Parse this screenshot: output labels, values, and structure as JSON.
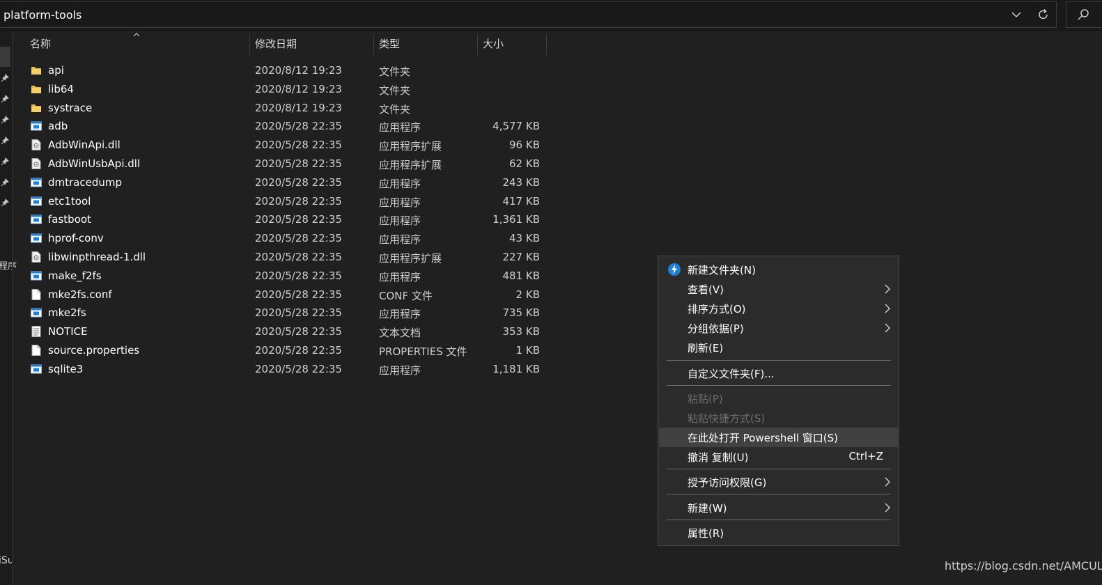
{
  "address_bar": {
    "path": "platform-tools"
  },
  "nav_pane": {
    "partial_label_1": "程序",
    "partial_label_2": "iSu"
  },
  "columns": {
    "name": "名称",
    "date": "修改日期",
    "type": "类型",
    "size": "大小"
  },
  "files": [
    {
      "name": "api",
      "date": "2020/8/12 19:23",
      "type": "文件夹",
      "size": "",
      "icon": "folder-icon"
    },
    {
      "name": "lib64",
      "date": "2020/8/12 19:23",
      "type": "文件夹",
      "size": "",
      "icon": "folder-icon"
    },
    {
      "name": "systrace",
      "date": "2020/8/12 19:23",
      "type": "文件夹",
      "size": "",
      "icon": "folder-icon"
    },
    {
      "name": "adb",
      "date": "2020/5/28 22:35",
      "type": "应用程序",
      "size": "4,577 KB",
      "icon": "application-icon"
    },
    {
      "name": "AdbWinApi.dll",
      "date": "2020/5/28 22:35",
      "type": "应用程序扩展",
      "size": "96 KB",
      "icon": "dll-icon"
    },
    {
      "name": "AdbWinUsbApi.dll",
      "date": "2020/5/28 22:35",
      "type": "应用程序扩展",
      "size": "62 KB",
      "icon": "dll-icon"
    },
    {
      "name": "dmtracedump",
      "date": "2020/5/28 22:35",
      "type": "应用程序",
      "size": "243 KB",
      "icon": "application-icon"
    },
    {
      "name": "etc1tool",
      "date": "2020/5/28 22:35",
      "type": "应用程序",
      "size": "417 KB",
      "icon": "application-icon"
    },
    {
      "name": "fastboot",
      "date": "2020/5/28 22:35",
      "type": "应用程序",
      "size": "1,361 KB",
      "icon": "application-icon"
    },
    {
      "name": "hprof-conv",
      "date": "2020/5/28 22:35",
      "type": "应用程序",
      "size": "43 KB",
      "icon": "application-icon"
    },
    {
      "name": "libwinpthread-1.dll",
      "date": "2020/5/28 22:35",
      "type": "应用程序扩展",
      "size": "227 KB",
      "icon": "dll-icon"
    },
    {
      "name": "make_f2fs",
      "date": "2020/5/28 22:35",
      "type": "应用程序",
      "size": "481 KB",
      "icon": "application-icon"
    },
    {
      "name": "mke2fs.conf",
      "date": "2020/5/28 22:35",
      "type": "CONF 文件",
      "size": "2 KB",
      "icon": "file-icon"
    },
    {
      "name": "mke2fs",
      "date": "2020/5/28 22:35",
      "type": "应用程序",
      "size": "735 KB",
      "icon": "application-icon"
    },
    {
      "name": "NOTICE",
      "date": "2020/5/28 22:35",
      "type": "文本文档",
      "size": "353 KB",
      "icon": "text-document-icon"
    },
    {
      "name": "source.properties",
      "date": "2020/5/28 22:35",
      "type": "PROPERTIES 文件",
      "size": "1 KB",
      "icon": "file-icon"
    },
    {
      "name": "sqlite3",
      "date": "2020/5/28 22:35",
      "type": "应用程序",
      "size": "1,181 KB",
      "icon": "application-icon"
    }
  ],
  "context_menu": {
    "new_folder": "新建文件夹(N)",
    "view": "查看(V)",
    "sort_by": "排序方式(O)",
    "group_by": "分组依据(P)",
    "refresh": "刷新(E)",
    "customize_folder": "自定义文件夹(F)...",
    "paste": "粘贴(P)",
    "paste_shortcut": "粘贴快捷方式(S)",
    "open_powershell": "在此处打开 Powershell 窗口(S)",
    "undo_copy": "撤消 复制(U)",
    "undo_copy_shortcut": "Ctrl+Z",
    "give_access": "授予访问权限(G)",
    "new": "新建(W)",
    "properties": "属性(R)"
  },
  "watermark": "https://blog.csdn.net/AMCUL",
  "colors": {
    "background": "#202020",
    "menu_background": "#2b2b2b",
    "menu_hover": "#414141",
    "folder": "#e8b84a",
    "app_icon": "#1e7fd6"
  }
}
